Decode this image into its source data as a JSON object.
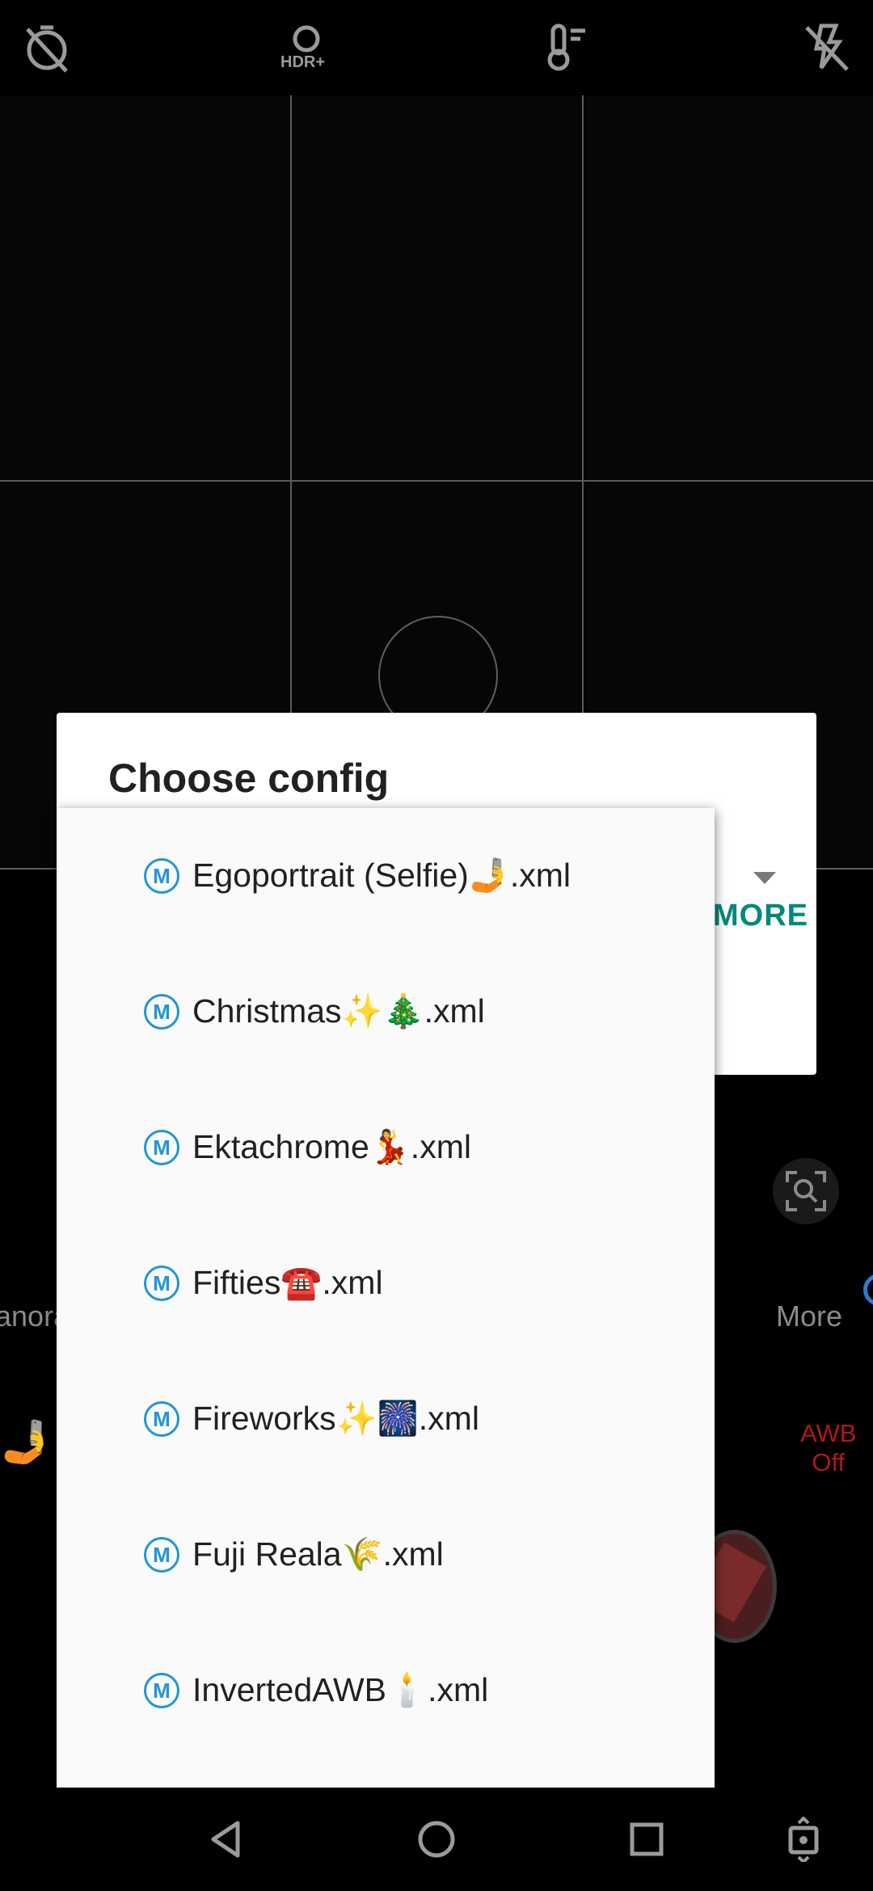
{
  "top_bar": {
    "icons": [
      "timer-off-icon",
      "hdr-plus-icon",
      "temperature-icon",
      "flash-off-icon"
    ],
    "hdr_label": "HDR+"
  },
  "camera": {
    "mode_left": "anora",
    "mode_right": "More",
    "awb_line1": "AWB",
    "awb_line2": "Off",
    "selfie_emoji": "🤳"
  },
  "dialog": {
    "title": "Choose config",
    "more_button": "MORE"
  },
  "dropdown": {
    "badge": "M",
    "items": [
      {
        "label": "Egoportrait (Selfie)🤳.xml"
      },
      {
        "label": "Christmas✨🎄.xml"
      },
      {
        "label": "Ektachrome💃.xml"
      },
      {
        "label": "Fifties☎️.xml"
      },
      {
        "label": "Fireworks✨🎆.xml"
      },
      {
        "label": "Fuji Reala🌾.xml"
      },
      {
        "label": "InvertedAWB🕯️.xml"
      }
    ]
  },
  "nav_bar": {
    "icons": [
      "back-icon",
      "home-icon",
      "recents-icon",
      "rotate-icon"
    ]
  },
  "colors": {
    "accent": "#00897b",
    "badge": "#2196d3",
    "awb": "#b01818"
  }
}
